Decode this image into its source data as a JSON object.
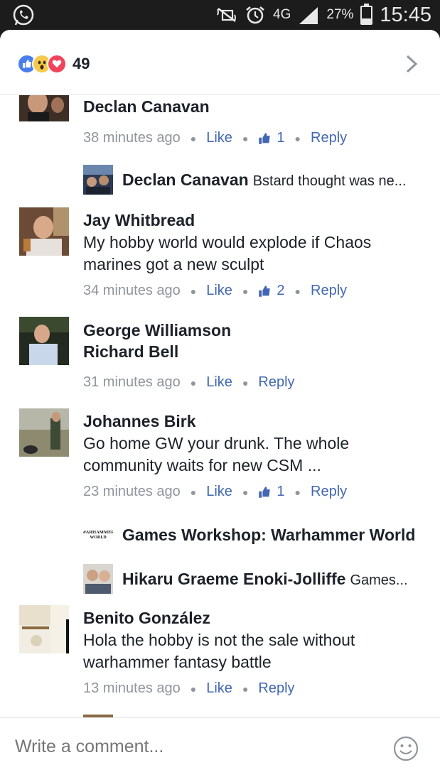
{
  "status_bar": {
    "network": "4G",
    "battery_pct": "27%",
    "battery_level": 0.27,
    "time": "15:45"
  },
  "reactions": {
    "types": [
      "like-icon",
      "wow-icon",
      "love-icon"
    ],
    "count": "49"
  },
  "comments": [
    {
      "name": "Declan Canavan",
      "time": "38 minutes ago",
      "like_label": "Like",
      "likes": "1",
      "reply_label": "Reply"
    },
    {
      "reply_preview": true,
      "name": "Declan Canavan",
      "text": "Bstard thought was ne..."
    },
    {
      "name": "Jay Whitbread",
      "text": "My hobby world would explode if Chaos marines got a new sculpt",
      "time": "34 minutes ago",
      "like_label": "Like",
      "likes": "2",
      "reply_label": "Reply"
    },
    {
      "name": "George Williamson",
      "tag": "Richard Bell",
      "time": "31 minutes ago",
      "like_label": "Like",
      "reply_label": "Reply"
    },
    {
      "name": "Johannes Birk",
      "text": "Go home GW your drunk. The whole community waits for new CSM ...",
      "time": "23 minutes ago",
      "like_label": "Like",
      "likes": "1",
      "reply_label": "Reply"
    },
    {
      "reply_preview": true,
      "name": "Games Workshop: Warhammer World",
      "logo_text": "Warhammer World"
    },
    {
      "reply_preview": true,
      "name": "Hikaru Graeme Enoki-Jolliffe",
      "text": "Games..."
    },
    {
      "name": "Benito González",
      "text": "Hola the hobby is not the sale without warhammer fantasy battle",
      "time": "13 minutes ago",
      "like_label": "Like",
      "reply_label": "Reply"
    }
  ],
  "composer": {
    "placeholder": "Write a comment..."
  },
  "colors": {
    "link": "#4267b2",
    "meta": "#90949c",
    "text": "#1d2129"
  }
}
